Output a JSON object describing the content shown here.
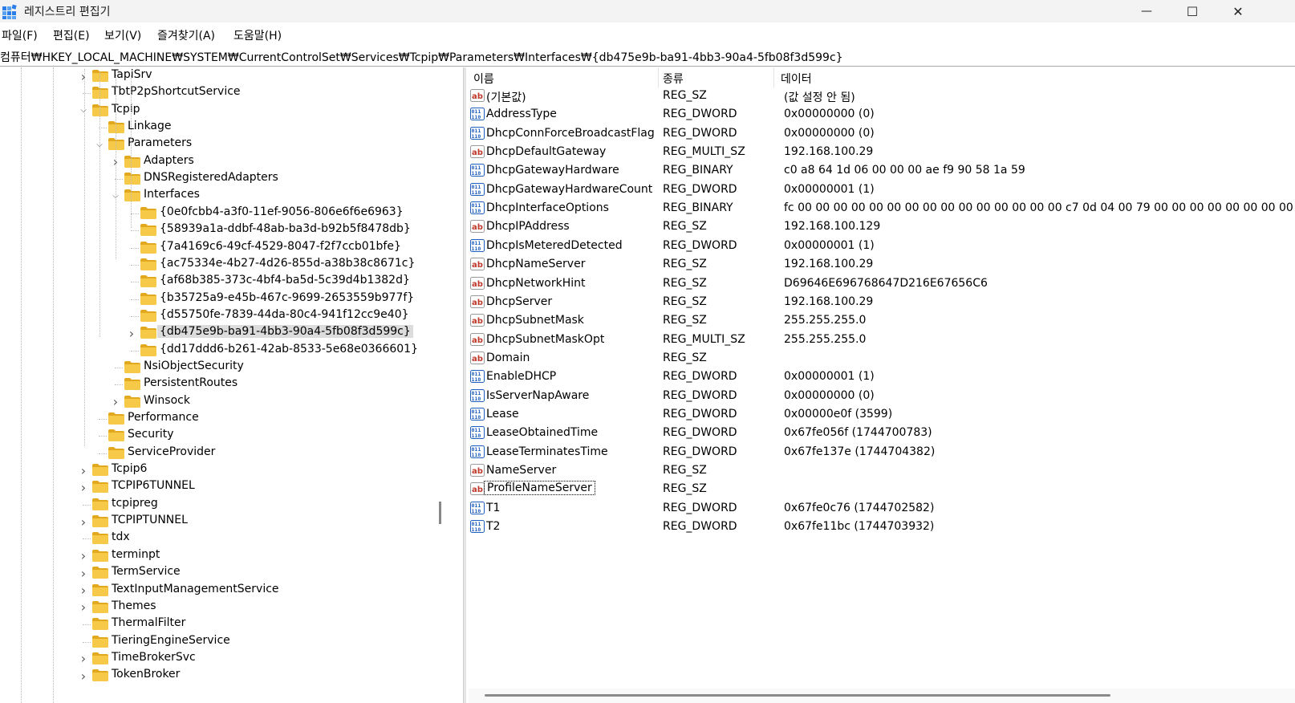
{
  "window": {
    "title": "레지스트리 편집기",
    "minimize": "—",
    "maximize": "☐",
    "close": "✕"
  },
  "menu": [
    "파일(F)",
    "편집(E)",
    "보기(V)",
    "즐겨찾기(A)",
    "도움말(H)"
  ],
  "address": "컴퓨터₩HKEY_LOCAL_MACHINE₩SYSTEM₩CurrentControlSet₩Services₩Tcpip₩Parameters₩Interfaces₩{db475e9b-ba91-4bb3-90a4-5fb08f3d599c}",
  "tree": [
    {
      "label": "TapiSrv",
      "level": 0,
      "expander": "collapsed"
    },
    {
      "label": "TbtP2pShortcutService",
      "level": 0,
      "expander": "none"
    },
    {
      "label": "Tcpip",
      "level": 0,
      "expander": "expanded"
    },
    {
      "label": "Linkage",
      "level": 1,
      "expander": "none"
    },
    {
      "label": "Parameters",
      "level": 1,
      "expander": "expanded"
    },
    {
      "label": "Adapters",
      "level": 2,
      "expander": "collapsed"
    },
    {
      "label": "DNSRegisteredAdapters",
      "level": 2,
      "expander": "none"
    },
    {
      "label": "Interfaces",
      "level": 2,
      "expander": "expanded"
    },
    {
      "label": "{0e0fcbb4-a3f0-11ef-9056-806e6f6e6963}",
      "level": 3,
      "expander": "none"
    },
    {
      "label": "{58939a1a-ddbf-48ab-ba3d-b92b5f8478db}",
      "level": 3,
      "expander": "none"
    },
    {
      "label": "{7a4169c6-49cf-4529-8047-f2f7ccb01bfe}",
      "level": 3,
      "expander": "none"
    },
    {
      "label": "{ac75334e-4b27-4d26-855d-a38b38c8671c}",
      "level": 3,
      "expander": "none"
    },
    {
      "label": "{af68b385-373c-4bf4-ba5d-5c39d4b1382d}",
      "level": 3,
      "expander": "none"
    },
    {
      "label": "{b35725a9-e45b-467c-9699-2653559b977f}",
      "level": 3,
      "expander": "none"
    },
    {
      "label": "{d55750fe-7839-44da-80c4-941f12cc9e40}",
      "level": 3,
      "expander": "none"
    },
    {
      "label": "{db475e9b-ba91-4bb3-90a4-5fb08f3d599c}",
      "level": 3,
      "expander": "collapsed",
      "selected": true
    },
    {
      "label": "{dd17ddd6-b261-42ab-8533-5e68e0366601}",
      "level": 3,
      "expander": "none"
    },
    {
      "label": "NsiObjectSecurity",
      "level": 2,
      "expander": "none"
    },
    {
      "label": "PersistentRoutes",
      "level": 2,
      "expander": "none"
    },
    {
      "label": "Winsock",
      "level": 2,
      "expander": "collapsed"
    },
    {
      "label": "Performance",
      "level": 1,
      "expander": "none"
    },
    {
      "label": "Security",
      "level": 1,
      "expander": "none"
    },
    {
      "label": "ServiceProvider",
      "level": 1,
      "expander": "none"
    },
    {
      "label": "Tcpip6",
      "level": 0,
      "expander": "collapsed"
    },
    {
      "label": "TCPIP6TUNNEL",
      "level": 0,
      "expander": "collapsed"
    },
    {
      "label": "tcpipreg",
      "level": 0,
      "expander": "none"
    },
    {
      "label": "TCPIPTUNNEL",
      "level": 0,
      "expander": "collapsed"
    },
    {
      "label": "tdx",
      "level": 0,
      "expander": "none"
    },
    {
      "label": "terminpt",
      "level": 0,
      "expander": "collapsed"
    },
    {
      "label": "TermService",
      "level": 0,
      "expander": "collapsed"
    },
    {
      "label": "TextInputManagementService",
      "level": 0,
      "expander": "collapsed"
    },
    {
      "label": "Themes",
      "level": 0,
      "expander": "collapsed"
    },
    {
      "label": "ThermalFilter",
      "level": 0,
      "expander": "none"
    },
    {
      "label": "TieringEngineService",
      "level": 0,
      "expander": "none"
    },
    {
      "label": "TimeBrokerSvc",
      "level": 0,
      "expander": "collapsed"
    },
    {
      "label": "TokenBroker",
      "level": 0,
      "expander": "collapsed"
    }
  ],
  "columns": {
    "name": "이름",
    "type": "종류",
    "data": "데이터"
  },
  "values": [
    {
      "icon": "ab",
      "name": "(기본값)",
      "type": "REG_SZ",
      "data": "(값 설정 안 됨)"
    },
    {
      "icon": "bin",
      "name": "AddressType",
      "type": "REG_DWORD",
      "data": "0x00000000 (0)"
    },
    {
      "icon": "bin",
      "name": "DhcpConnForceBroadcastFlag",
      "type": "REG_DWORD",
      "data": "0x00000000 (0)"
    },
    {
      "icon": "ab",
      "name": "DhcpDefaultGateway",
      "type": "REG_MULTI_SZ",
      "data": "192.168.100.29"
    },
    {
      "icon": "bin",
      "name": "DhcpGatewayHardware",
      "type": "REG_BINARY",
      "data": "c0 a8 64 1d 06 00 00 00 ae f9 90 58 1a 59"
    },
    {
      "icon": "bin",
      "name": "DhcpGatewayHardwareCount",
      "type": "REG_DWORD",
      "data": "0x00000001 (1)"
    },
    {
      "icon": "bin",
      "name": "DhcpInterfaceOptions",
      "type": "REG_BINARY",
      "data": "fc 00 00 00 00 00 00 00 00 00 00 00 00 00 00 00 c7 0d 04 00 79 00 00 00 00 00 00 00 00 00 00"
    },
    {
      "icon": "ab",
      "name": "DhcpIPAddress",
      "type": "REG_SZ",
      "data": "192.168.100.129"
    },
    {
      "icon": "bin",
      "name": "DhcpIsMeteredDetected",
      "type": "REG_DWORD",
      "data": "0x00000001 (1)"
    },
    {
      "icon": "ab",
      "name": "DhcpNameServer",
      "type": "REG_SZ",
      "data": "192.168.100.29"
    },
    {
      "icon": "ab",
      "name": "DhcpNetworkHint",
      "type": "REG_SZ",
      "data": "D69646E696768647D216E67656C6"
    },
    {
      "icon": "ab",
      "name": "DhcpServer",
      "type": "REG_SZ",
      "data": "192.168.100.29"
    },
    {
      "icon": "ab",
      "name": "DhcpSubnetMask",
      "type": "REG_SZ",
      "data": "255.255.255.0"
    },
    {
      "icon": "ab",
      "name": "DhcpSubnetMaskOpt",
      "type": "REG_MULTI_SZ",
      "data": "255.255.255.0"
    },
    {
      "icon": "ab",
      "name": "Domain",
      "type": "REG_SZ",
      "data": ""
    },
    {
      "icon": "bin",
      "name": "EnableDHCP",
      "type": "REG_DWORD",
      "data": "0x00000001 (1)"
    },
    {
      "icon": "bin",
      "name": "IsServerNapAware",
      "type": "REG_DWORD",
      "data": "0x00000000 (0)"
    },
    {
      "icon": "bin",
      "name": "Lease",
      "type": "REG_DWORD",
      "data": "0x00000e0f (3599)"
    },
    {
      "icon": "bin",
      "name": "LeaseObtainedTime",
      "type": "REG_DWORD",
      "data": "0x67fe056f (1744700783)"
    },
    {
      "icon": "bin",
      "name": "LeaseTerminatesTime",
      "type": "REG_DWORD",
      "data": "0x67fe137e (1744704382)"
    },
    {
      "icon": "ab",
      "name": "NameServer",
      "type": "REG_SZ",
      "data": ""
    },
    {
      "icon": "ab",
      "name": "ProfileNameServer",
      "type": "REG_SZ",
      "data": "",
      "focused": true
    },
    {
      "icon": "bin",
      "name": "T1",
      "type": "REG_DWORD",
      "data": "0x67fe0c76 (1744702582)"
    },
    {
      "icon": "bin",
      "name": "T2",
      "type": "REG_DWORD",
      "data": "0x67fe11bc (1744703932)"
    }
  ],
  "colors": {
    "folder": "#f7c948",
    "folder_dark": "#e3a91e",
    "selection": "#dcdcdc",
    "icon_ab": "#c0392b",
    "icon_bin": "#1f5fbf"
  }
}
